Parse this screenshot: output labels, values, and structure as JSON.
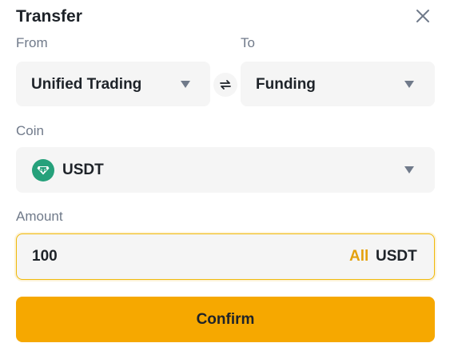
{
  "dialog": {
    "title": "Transfer"
  },
  "from": {
    "label": "From",
    "value": "Unified Trading"
  },
  "to": {
    "label": "To",
    "value": "Funding"
  },
  "coin": {
    "label": "Coin",
    "value": "USDT",
    "icon": "tether-icon",
    "icon_color": "#26a17b"
  },
  "amount": {
    "label": "Amount",
    "value": "100",
    "all_label": "All",
    "unit": "USDT"
  },
  "confirm_label": "Confirm",
  "colors": {
    "accent": "#f6a800",
    "all_link": "#e4a10d",
    "field_bg": "#f5f5f5"
  }
}
